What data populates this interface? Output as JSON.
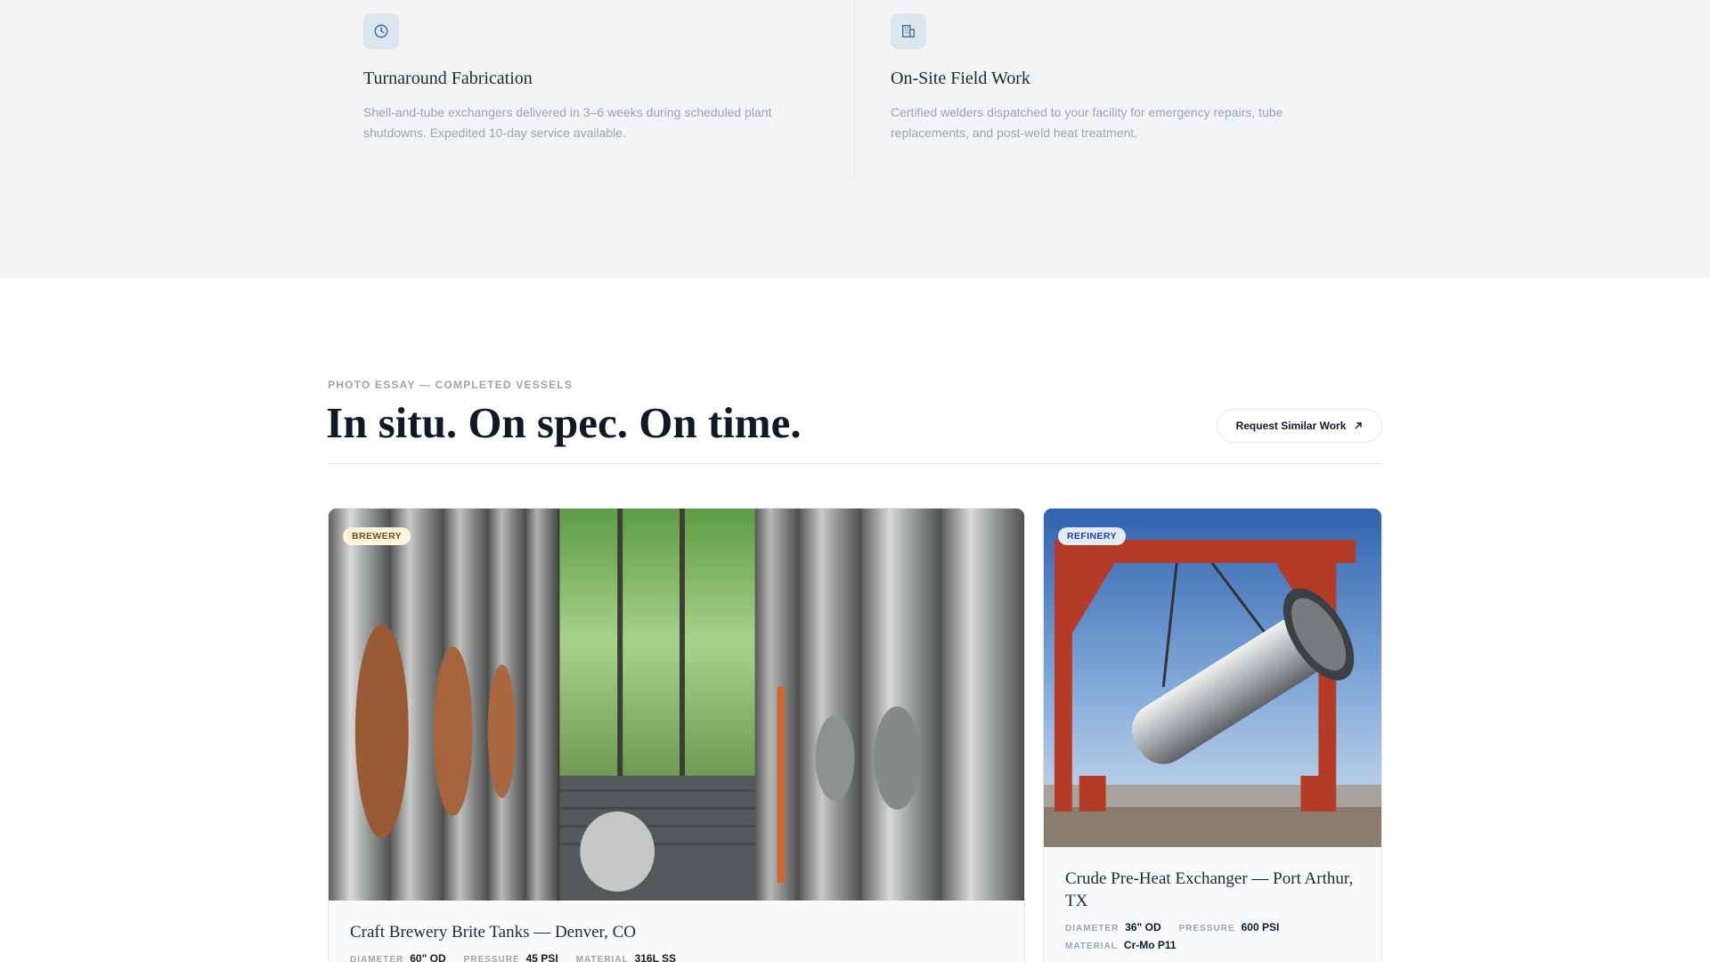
{
  "features": [
    {
      "icon": "clock-icon",
      "title": "Turnaround Fabrication",
      "description": "Shell-and-tube exchangers delivered in 3–6 weeks during scheduled plant shutdowns. Expedited 10-day service available."
    },
    {
      "icon": "building-icon",
      "title": "On-Site Field Work",
      "description": "Certified welders dispatched to your facility for emergency repairs, tube replacements, and post-weld heat treatment."
    }
  ],
  "section": {
    "eyebrow": "PHOTO ESSAY — COMPLETED VESSELS",
    "headline": "In situ. On spec. On time.",
    "cta_label": "Request Similar Work"
  },
  "cards": [
    {
      "badge": "BREWERY",
      "title": "Craft Brewery Brite Tanks — Denver, CO",
      "specs": [
        {
          "label": "DIAMETER",
          "value": "60\" OD"
        },
        {
          "label": "PRESSURE",
          "value": "45 PSI"
        },
        {
          "label": "MATERIAL",
          "value": "316L SS"
        }
      ]
    },
    {
      "badge": "REFINERY",
      "title": "Crude Pre-Heat Exchanger — Port Arthur, TX",
      "specs": [
        {
          "label": "DIAMETER",
          "value": "36\" OD"
        },
        {
          "label": "PRESSURE",
          "value": "600 PSI"
        },
        {
          "label": "MATERIAL",
          "value": "Cr-Mo P11"
        }
      ]
    }
  ],
  "colors": {
    "band_bg": "#f3f4f6",
    "icon_tint": "#3b6ea5",
    "brewery_badge": "#fdf5dc",
    "refinery_badge": "#e3ebf7"
  }
}
